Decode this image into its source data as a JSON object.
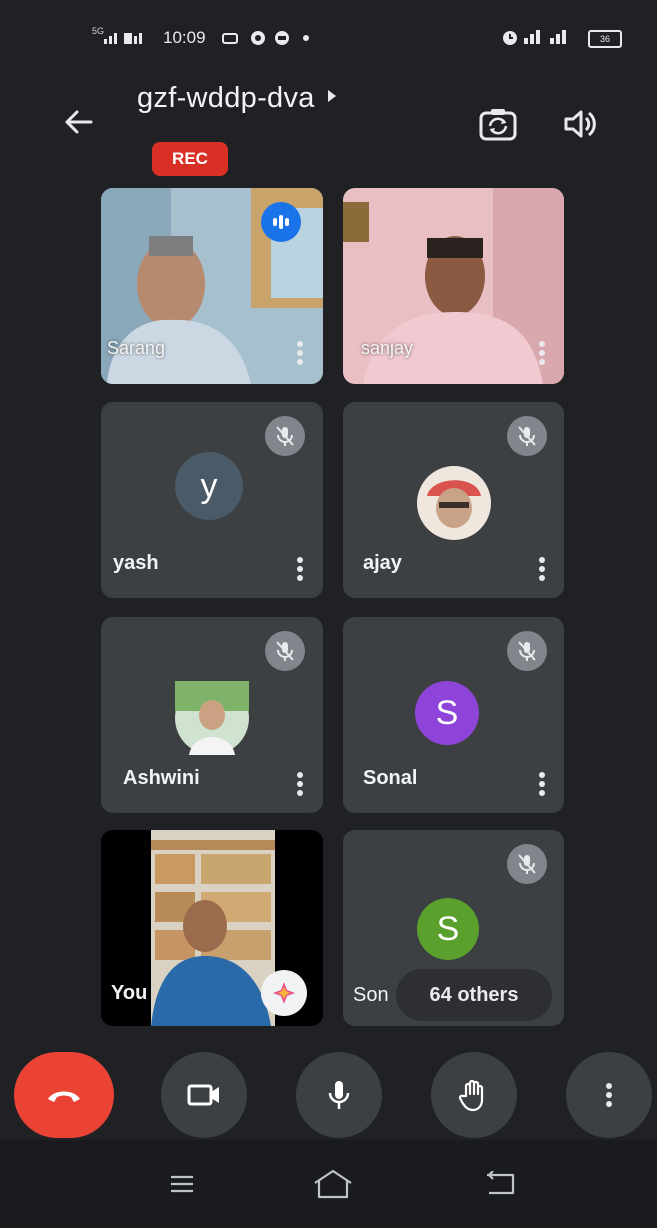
{
  "status_bar": {
    "left_signal_1": "5G",
    "time": "10:09",
    "battery": "36"
  },
  "header": {
    "meeting_code": "gzf-wddp-dva",
    "rec_badge": "REC"
  },
  "participants": [
    {
      "name": "Sarang",
      "type": "video",
      "speaking": true
    },
    {
      "name": "sanjay",
      "type": "video"
    },
    {
      "name": "yash",
      "type": "avatar",
      "initial": "y",
      "color": "#4a5a66",
      "muted": true
    },
    {
      "name": "ajay",
      "type": "photo",
      "muted": true
    },
    {
      "name": "Ashwini",
      "type": "photo",
      "muted": true
    },
    {
      "name": "Sonal",
      "type": "avatar",
      "initial": "S",
      "color": "#8e44d9",
      "muted": true
    },
    {
      "name": "You",
      "type": "video"
    },
    {
      "name": "Sonal",
      "type": "avatar",
      "initial": "S",
      "color": "#5aa02c",
      "muted": true,
      "truncated_label": "Son"
    }
  ],
  "others_pill": "64 others",
  "controls": {
    "end_call": "phone-hangup-icon",
    "camera": "video-camera-icon",
    "mic": "microphone-icon",
    "raise_hand": "raise-hand-icon",
    "more": "more-vert-icon"
  },
  "colors": {
    "background": "#1f2124",
    "tile": "#3c4043",
    "end_call": "#ea4335",
    "rec": "#d93025"
  }
}
